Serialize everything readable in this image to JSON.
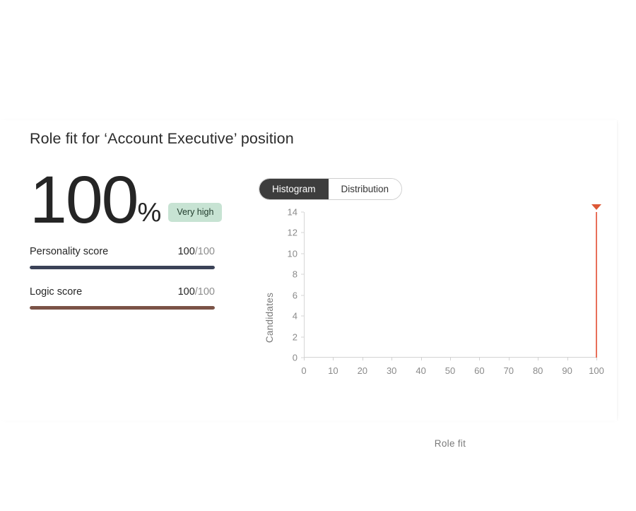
{
  "page": {
    "title": "Role fit for ‘Account Executive’ position"
  },
  "summary": {
    "score_number": "100",
    "score_unit": "%",
    "badge_label": "Very high",
    "badge_color": "#c7e3d3"
  },
  "scores": [
    {
      "label": "Personality score",
      "value": "100",
      "denominator": "/100",
      "percent": 100,
      "color": "#3b4257"
    },
    {
      "label": "Logic score",
      "value": "100",
      "denominator": "/100",
      "percent": 100,
      "color": "#7b5347"
    }
  ],
  "tabs": [
    {
      "label": "Histogram",
      "active": true
    },
    {
      "label": "Distribution",
      "active": false
    }
  ],
  "chart_data": {
    "type": "bar",
    "title": "",
    "xlabel": "Role fit",
    "ylabel": "Candidates",
    "categories": [
      100
    ],
    "values": [
      14
    ],
    "x": [
      100
    ],
    "xlim": [
      0,
      100
    ],
    "ylim": [
      0,
      14
    ],
    "xticks": [
      "0",
      "10",
      "20",
      "30",
      "40",
      "50",
      "60",
      "70",
      "80",
      "90",
      "100"
    ],
    "yticks": [
      "0",
      "2",
      "4",
      "6",
      "8",
      "10",
      "12",
      "14"
    ],
    "grid": false,
    "legend": null,
    "bar_color": "#e8705a",
    "marker": {
      "shape": "triangle-down",
      "x": 100,
      "color": "#dd5836"
    },
    "annotations": []
  }
}
